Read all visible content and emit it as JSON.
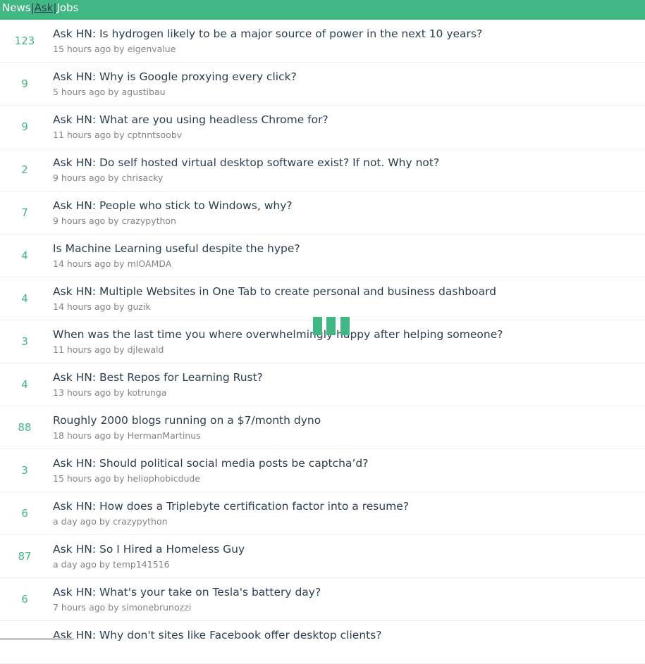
{
  "nav": {
    "news": "News",
    "ask": "Ask",
    "jobs": "Jobs",
    "separator": "|",
    "active": "Ask"
  },
  "colors": {
    "brand": "#41b883",
    "text": "#2c3e50",
    "meta": "#828282",
    "divider": "#eeeeee"
  },
  "items": [
    {
      "score": "123",
      "title": "Ask HN: Is hydrogen likely to be a major source of power in the next 10 years?",
      "time": "15 hours ago",
      "by": "by",
      "user": "eigenvalue"
    },
    {
      "score": "9",
      "title": "Ask HN: Why is Google proxying every click?",
      "time": "5 hours ago",
      "by": "by",
      "user": "agustibau"
    },
    {
      "score": "9",
      "title": "Ask HN: What are you using headless Chrome for?",
      "time": "11 hours ago",
      "by": "by",
      "user": "cptnntsoobv"
    },
    {
      "score": "2",
      "title": "Ask HN: Do self hosted virtual desktop software exist? If not. Why not?",
      "time": "9 hours ago",
      "by": "by",
      "user": "chrisacky"
    },
    {
      "score": "7",
      "title": "Ask HN: People who stick to Windows, why?",
      "time": "9 hours ago",
      "by": "by",
      "user": "crazypython"
    },
    {
      "score": "4",
      "title": "Is Machine Learning useful despite the hype?",
      "time": "14 hours ago",
      "by": "by",
      "user": "mIOAMDA"
    },
    {
      "score": "4",
      "title": "Ask HN: Multiple Websites in One Tab to create personal and business dashboard",
      "time": "14 hours ago",
      "by": "by",
      "user": "guzik"
    },
    {
      "score": "3",
      "title": "When was the last time you where overwhelmingly happy after helping someone?",
      "time": "11 hours ago",
      "by": "by",
      "user": "djlewald"
    },
    {
      "score": "4",
      "title": "Ask HN: Best Repos for Learning Rust?",
      "time": "13 hours ago",
      "by": "by",
      "user": "kotrunga"
    },
    {
      "score": "88",
      "title": "Roughly 2000 blogs running on a $7/month dyno",
      "time": "18 hours ago",
      "by": "by",
      "user": "HermanMartinus"
    },
    {
      "score": "3",
      "title": "Ask HN: Should political social media posts be captcha’d?",
      "time": "15 hours ago",
      "by": "by",
      "user": "heliophobicdude"
    },
    {
      "score": "6",
      "title": "Ask HN: How does a Triplebyte certification factor into a resume?",
      "time": "a day ago",
      "by": "by",
      "user": "crazypython"
    },
    {
      "score": "87",
      "title": "Ask HN: So I Hired a Homeless Guy",
      "time": "a day ago",
      "by": "by",
      "user": "temp141516"
    },
    {
      "score": "6",
      "title": "Ask HN: What's your take on Tesla's battery day?",
      "time": "7 hours ago",
      "by": "by",
      "user": "simonebrunozzi"
    },
    {
      "score": "",
      "title": "Ask HN: Why don't sites like Facebook offer desktop clients?",
      "time": "",
      "by": "",
      "user": ""
    }
  ]
}
